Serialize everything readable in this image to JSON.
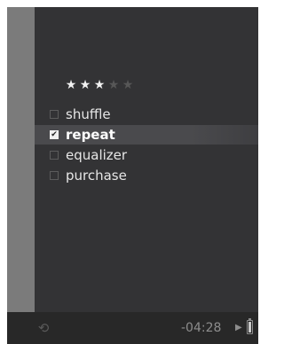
{
  "rating": {
    "value": 3,
    "max": 5,
    "stars": [
      "★",
      "★",
      "★",
      "★",
      "★"
    ]
  },
  "menu": {
    "items": [
      {
        "label": "shuffle",
        "checked": false,
        "highlighted": false
      },
      {
        "label": "repeat",
        "checked": true,
        "highlighted": true
      },
      {
        "label": "equalizer",
        "checked": false,
        "highlighted": false
      },
      {
        "label": "purchase",
        "checked": false,
        "highlighted": false
      }
    ],
    "check_glyph": "✔"
  },
  "status_bar": {
    "time_remaining": "-04:28",
    "play_glyph": "▶",
    "sync_glyph": "⟲",
    "battery_level": 0.85
  },
  "colors": {
    "screen_background": "#333335",
    "side_strip": "#7b7b7b",
    "status_bar_background": "#282828",
    "text": "#e6e6e6",
    "dim_text": "#8d8d8d"
  },
  "icons": {
    "sync": "sync-icon",
    "play": "play-icon",
    "battery": "battery-icon",
    "star": "star-icon",
    "checkbox": "checkbox-icon"
  }
}
